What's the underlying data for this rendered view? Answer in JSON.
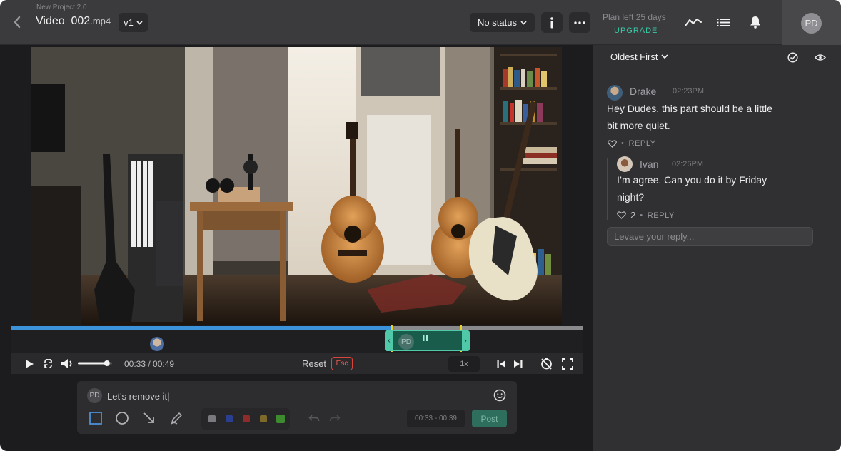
{
  "header": {
    "project_name": "New Project 2.0",
    "file_name": "Video_002",
    "file_ext": ".mp4",
    "version": "v1",
    "status": "No status",
    "plan_text": "Plan left 25 days",
    "upgrade_label": "UPGRADE",
    "user_initials": "PD"
  },
  "player": {
    "progress_fraction": 0.67,
    "current_time": "00:33 / 00:49",
    "reset_label": "Reset",
    "esc_label": "Esc",
    "speed": "1x",
    "range_initials": "PD",
    "volume_fraction": 0.85
  },
  "composer": {
    "initials": "PD",
    "text": "Let's remove it",
    "time_range": "00:33 - 00:39",
    "post_label": "Post",
    "colors": [
      "#7a7a7e",
      "#2a3f8f",
      "#8e2b2b",
      "#7d6a2b",
      "#3e8a2e"
    ]
  },
  "panel": {
    "sort_label": "Oldest First",
    "comments": [
      {
        "name": "Drake",
        "time": "02:23PM",
        "body_line1": "Hey Dudes, this part should be a little",
        "body_line2": "bit more quiet.",
        "likes": "",
        "reply_label": "REPLY"
      },
      {
        "name": "Ivan",
        "time": "02:26PM",
        "body_line1": "I’m agree. Can you do it by Friday",
        "body_line2": "night?",
        "likes": "2",
        "reply_label": "REPLY"
      }
    ],
    "reply_placeholder": "Levave your reply..."
  }
}
